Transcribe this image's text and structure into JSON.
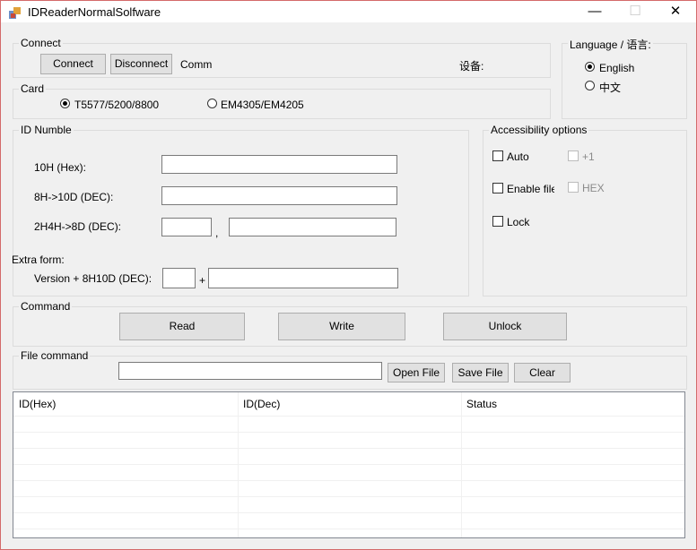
{
  "window": {
    "title": "IDReaderNormalSolfware",
    "minimize": "—",
    "maximize": "☐",
    "close": "✕"
  },
  "connect": {
    "legend": "Connect",
    "connect_button": "Connect",
    "disconnect_button": "Disconnect",
    "comm_label": "Comm",
    "device_label": "设备:"
  },
  "language": {
    "legend": "Language / 语言:",
    "english": "English",
    "chinese": "中文",
    "selected": "English"
  },
  "card": {
    "legend": "Card",
    "option1": "T5577/5200/8800",
    "option2": "EM4305/EM4205",
    "selected": "T5577/5200/8800"
  },
  "id": {
    "legend": "ID Numble",
    "hex_label": "10H (Hex):",
    "hex_value": "",
    "dec_label": "8H->10D (DEC):",
    "dec_value": "",
    "h2h4_label": "2H4H->8D (DEC):",
    "h2h4_value1": "",
    "comma": ",",
    "h2h4_value2": "",
    "extra_label": "Extra form:",
    "version_label": "Version + 8H10D (DEC):",
    "version_value": "",
    "plus": "+",
    "version_value2": ""
  },
  "accessibility": {
    "legend": "Accessibility options",
    "auto": "Auto",
    "plus1": "+1",
    "enable_file": "Enable file",
    "hex": "HEX",
    "lock": "Lock"
  },
  "command": {
    "legend": "Command",
    "read": "Read",
    "write": "Write",
    "unlock": "Unlock"
  },
  "file": {
    "legend": "File command",
    "path_value": "",
    "open": "Open File",
    "save": "Save File",
    "clear": "Clear"
  },
  "table": {
    "columns": [
      "ID(Hex)",
      "ID(Dec)",
      "Status"
    ],
    "rows": []
  }
}
